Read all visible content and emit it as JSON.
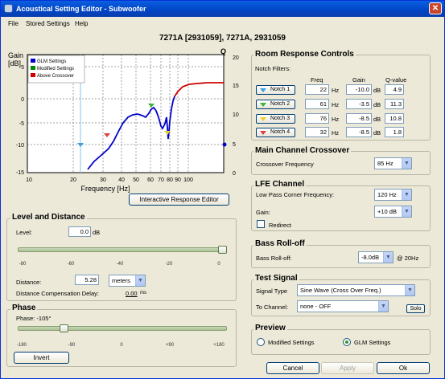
{
  "window": {
    "title": "Acoustical Setting Editor - Subwoofer",
    "close_glyph": "✕"
  },
  "menu": [
    "File",
    "Stored Settings",
    "Help"
  ],
  "headline": "7271A [2931059], 7271A, 2931059",
  "graph": {
    "ylabel": "Gain",
    "yunit": "[dB]",
    "ylabel_right": "Q",
    "xlabel": "Frequency [Hz]",
    "yticks": [
      "5",
      "0",
      "-5",
      "-10",
      "-15"
    ],
    "qticks": [
      "20",
      "15",
      "10",
      "5",
      "0"
    ],
    "xticks": [
      "10",
      "20",
      "30",
      "40",
      "50",
      "60",
      "70",
      "80",
      "90",
      "100"
    ],
    "legend": [
      {
        "label": "GLM Settings",
        "color": "#0000cc"
      },
      {
        "label": "Modified Settings",
        "color": "#008800"
      },
      {
        "label": "Above Crossover",
        "color": "#cc0000"
      }
    ]
  },
  "interactive_button": "Interactive Response Editor",
  "room": {
    "title": "Room Response Controls",
    "notch_label": "Notch Filters:",
    "col_freq": "Freq",
    "col_gain": "Gain",
    "col_q": "Q-value",
    "hz": "Hz",
    "db": "dB",
    "notches": [
      {
        "label": "Notch 1",
        "color": "#3aa0e0",
        "freq": "22",
        "gain": "-10.0",
        "q": "4.9"
      },
      {
        "label": "Notch 2",
        "color": "#3cb43c",
        "freq": "61",
        "gain": "-3.5",
        "q": "11.3"
      },
      {
        "label": "Notch 3",
        "color": "#e8d030",
        "freq": "76",
        "gain": "-8.5",
        "q": "10.8"
      },
      {
        "label": "Notch 4",
        "color": "#e04040",
        "freq": "32",
        "gain": "-8.5",
        "q": "1.8"
      }
    ]
  },
  "crossover": {
    "title": "Main Channel Crossover",
    "label": "Crossover Frequency",
    "value": "85 Hz"
  },
  "lfe": {
    "title": "LFE Channel",
    "lowpass_label": "Low Pass Corner Frequency:",
    "lowpass_value": "120 Hz",
    "gain_label": "Gain:",
    "gain_value": "+10 dB",
    "redirect": "Redirect"
  },
  "bass": {
    "title": "Bass Roll-off",
    "label": "Bass Roll-off:",
    "value": "-8.0dB",
    "suffix": "@ 20Hz"
  },
  "test": {
    "title": "Test Signal",
    "signal_label": "Signal Type",
    "signal_value": "Sine Wave  (Cross Over Freq.)",
    "channel_label": "To Channel:",
    "channel_value": "none - OFF",
    "solo": "Solo"
  },
  "preview": {
    "title": "Preview",
    "modified": "Modified Settings",
    "glm": "GLM Settings"
  },
  "level": {
    "title": "Level and Distance",
    "level_label": "Level:",
    "level_value": "0.0",
    "db": "dB",
    "ticks": [
      "-80",
      "-60",
      "-40",
      "-20",
      "0"
    ],
    "level_fraction": 1.0,
    "distance_label": "Distance:",
    "distance_value": "5.28",
    "distance_unit": "meters",
    "delay_label": "Distance Compensation Delay:",
    "delay_value": "0.00",
    "delay_unit": "ms"
  },
  "phase": {
    "title": "Phase",
    "label": "Phase: -105°",
    "ticks": [
      "-180",
      "-90",
      "0",
      "+90",
      "+180"
    ],
    "value_deg": -105,
    "invert": "Invert"
  },
  "buttons": {
    "cancel": "Cancel",
    "apply": "Apply",
    "ok": "Ok"
  }
}
